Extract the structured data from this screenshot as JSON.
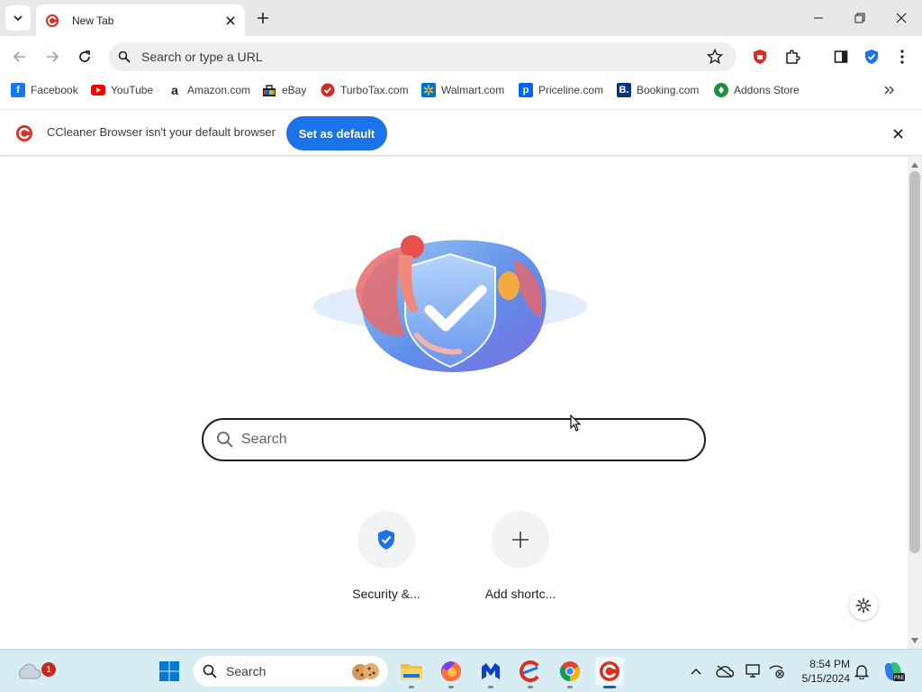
{
  "tab": {
    "title": "New Tab"
  },
  "omnibox": {
    "placeholder": "Search or type a URL"
  },
  "bookmarks": [
    {
      "label": "Facebook",
      "icon": "facebook-icon",
      "color": "#1877f2"
    },
    {
      "label": "YouTube",
      "icon": "youtube-icon",
      "color": "#ff0000"
    },
    {
      "label": "Amazon.com",
      "icon": "amazon-icon",
      "color": "#ffffff"
    },
    {
      "label": "eBay",
      "icon": "ebay-icon",
      "color": "#e53238"
    },
    {
      "label": "TurboTax.com",
      "icon": "turbotax-icon",
      "color": "#d52b1e"
    },
    {
      "label": "Walmart.com",
      "icon": "walmart-icon",
      "color": "#0071ce"
    },
    {
      "label": "Priceline.com",
      "icon": "priceline-icon",
      "color": "#0068ef"
    },
    {
      "label": "Booking.com",
      "icon": "booking-icon",
      "color": "#003580"
    },
    {
      "label": "Addons Store",
      "icon": "addons-store-icon",
      "color": "#1e8e3e"
    }
  ],
  "infobar": {
    "message": "CCleaner Browser isn't your default browser",
    "button": "Set as default"
  },
  "page": {
    "search_placeholder": "Search",
    "shortcuts": [
      {
        "label": "Security &...",
        "icon": "shield-check-icon"
      },
      {
        "label": "Add shortc...",
        "icon": "plus-icon"
      }
    ]
  },
  "taskbar": {
    "search_placeholder": "Search",
    "weather_badge": "1",
    "time": "8:54 PM",
    "date": "5/15/2024",
    "apps": [
      "file-explorer-icon",
      "firefox-icon",
      "malwarebytes-icon",
      "ccleaner-icon",
      "chrome-icon",
      "ccleaner-browser-icon"
    ]
  },
  "colors": {
    "accent": "#1a73e8",
    "brand_red": "#d93025",
    "taskbar_bg": "#d8ecf4"
  }
}
